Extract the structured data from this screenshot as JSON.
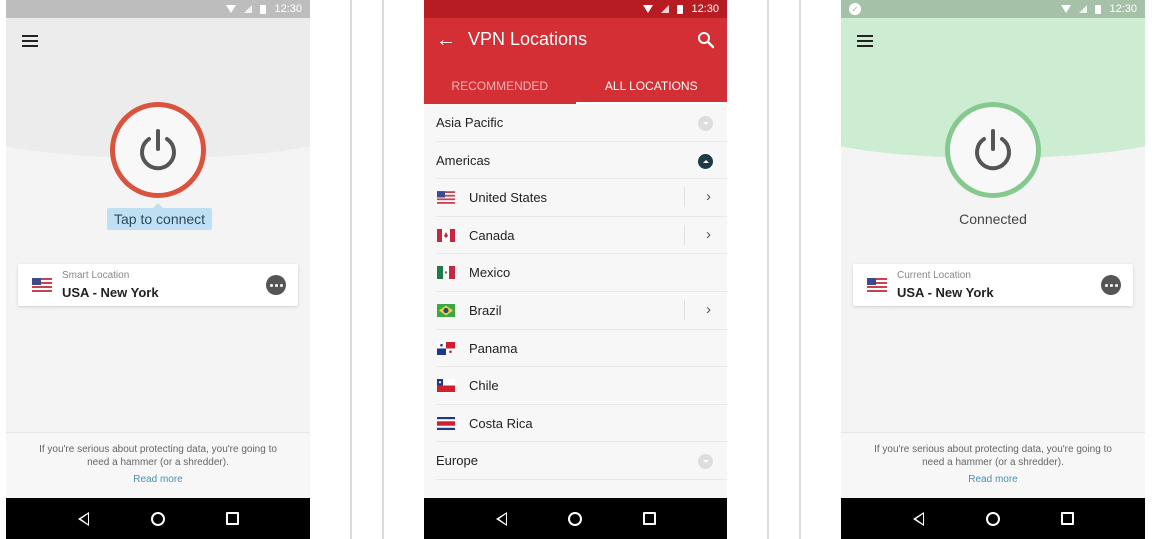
{
  "status_bar": {
    "time": "12:30"
  },
  "left_screen": {
    "tooltip": "Tap to connect",
    "location_card": {
      "sublabel": "Smart Location",
      "location": "USA - New York",
      "flag": "us-flag"
    },
    "footer": {
      "text": "If you're serious about protecting data, you're going to need a hammer (or a shredder).",
      "link": "Read more"
    },
    "power_color": "#d9533f"
  },
  "middle_screen": {
    "title": "VPN Locations",
    "tabs": [
      {
        "label": "RECOMMENDED",
        "active": false
      },
      {
        "label": "ALL LOCATIONS",
        "active": true
      }
    ],
    "accent": "#d32f35",
    "regions": [
      {
        "label": "Asia Pacific",
        "expanded": false
      },
      {
        "label": "Americas",
        "expanded": true
      },
      {
        "label": "Europe",
        "expanded": false
      }
    ],
    "countries": [
      {
        "label": "United States",
        "flag": "us-flag",
        "has_submenu": true
      },
      {
        "label": "Canada",
        "flag": "ca-flag",
        "has_submenu": true
      },
      {
        "label": "Mexico",
        "flag": "mx-flag",
        "has_submenu": false
      },
      {
        "label": "Brazil",
        "flag": "br-flag",
        "has_submenu": true
      },
      {
        "label": "Panama",
        "flag": "pa-flag",
        "has_submenu": false
      },
      {
        "label": "Chile",
        "flag": "cl-flag",
        "has_submenu": false
      },
      {
        "label": "Costa Rica",
        "flag": "cr-flag",
        "has_submenu": false
      }
    ]
  },
  "right_screen": {
    "status": "Connected",
    "location_card": {
      "sublabel": "Current Location",
      "location": "USA - New York",
      "flag": "us-flag"
    },
    "footer": {
      "text": "If you're serious about protecting data, you're going to need a hammer (or a shredder).",
      "link": "Read more"
    },
    "power_color": "#86c98f"
  },
  "icons": {
    "chevron": "›",
    "back_arrow": "←"
  }
}
